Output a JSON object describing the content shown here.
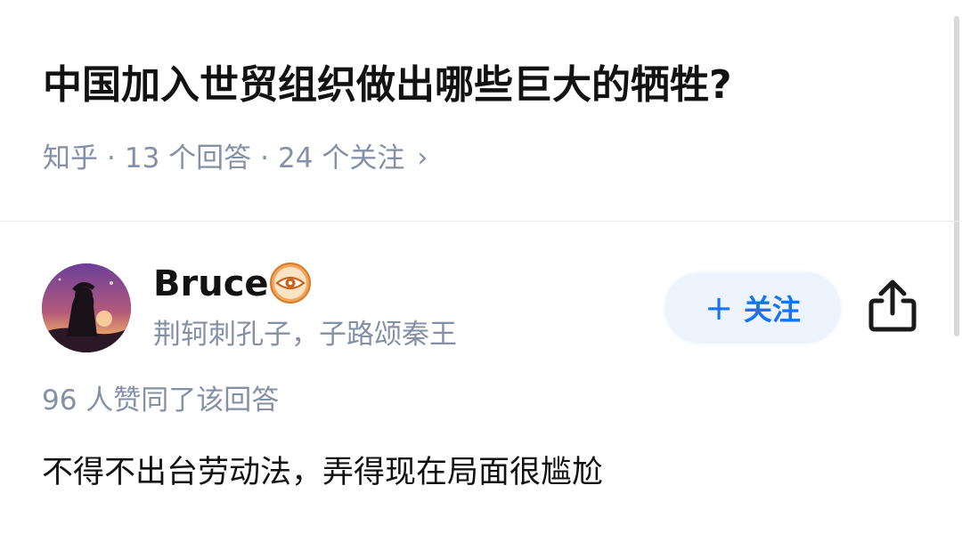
{
  "question": {
    "title": "中国加入世贸组织做出哪些巨大的牺牲?",
    "source": "知乎",
    "answers": "13 个回答",
    "followers": "24 个关注",
    "separator": "·",
    "chevron": "›"
  },
  "author": {
    "name": "Bruce",
    "bio": "荆轲刺孔子，子路颂秦王",
    "badge_icon": "eye-badge-icon",
    "avatar_icon": "avatar-image"
  },
  "actions": {
    "follow_plus": "+",
    "follow_label": "关注",
    "share_icon": "share-icon"
  },
  "answer": {
    "upvotes": "96 人赞同了该回答",
    "content": "不得不出台劳动法，弄得现在局面很尴尬"
  },
  "colors": {
    "text_primary": "#121212",
    "text_secondary": "#8590a6",
    "accent": "#1772f6",
    "follow_bg": "#eef4fd",
    "badge": "#e8873a"
  }
}
